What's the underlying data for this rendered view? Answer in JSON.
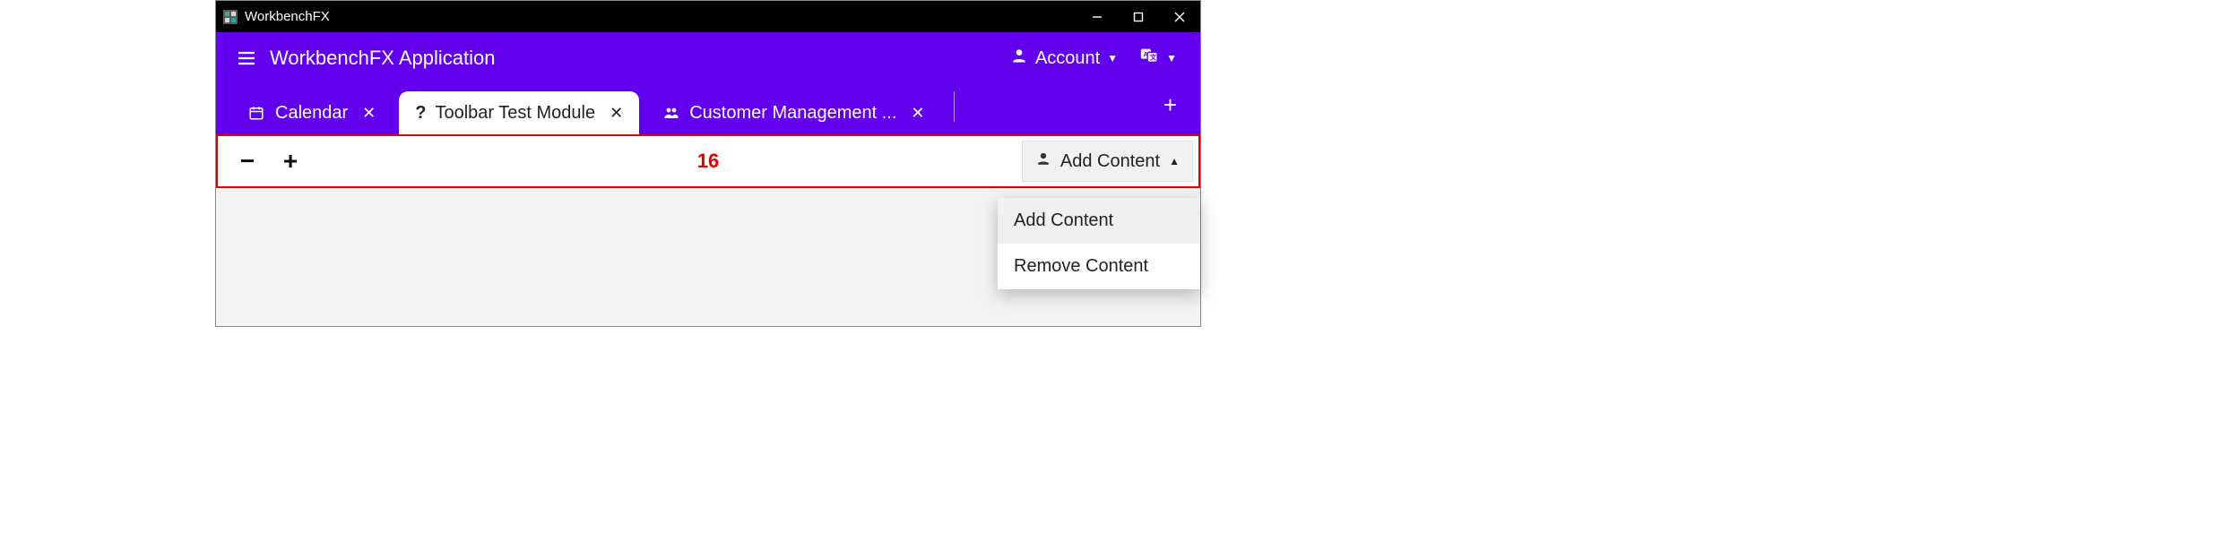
{
  "window": {
    "title": "WorkbenchFX"
  },
  "header": {
    "app_title": "WorkbenchFX Application",
    "account_label": "Account"
  },
  "tabs": [
    {
      "label": "Calendar",
      "icon": "calendar-icon",
      "active": false
    },
    {
      "label": "Toolbar Test Module",
      "icon": "question-icon",
      "active": true
    },
    {
      "label": "Customer Management ...",
      "icon": "people-icon",
      "active": false
    }
  ],
  "toolbar": {
    "annotation_count": "16",
    "add_content_label": "Add Content"
  },
  "dropdown": {
    "items": [
      {
        "label": "Add Content"
      },
      {
        "label": "Remove Content"
      }
    ]
  }
}
